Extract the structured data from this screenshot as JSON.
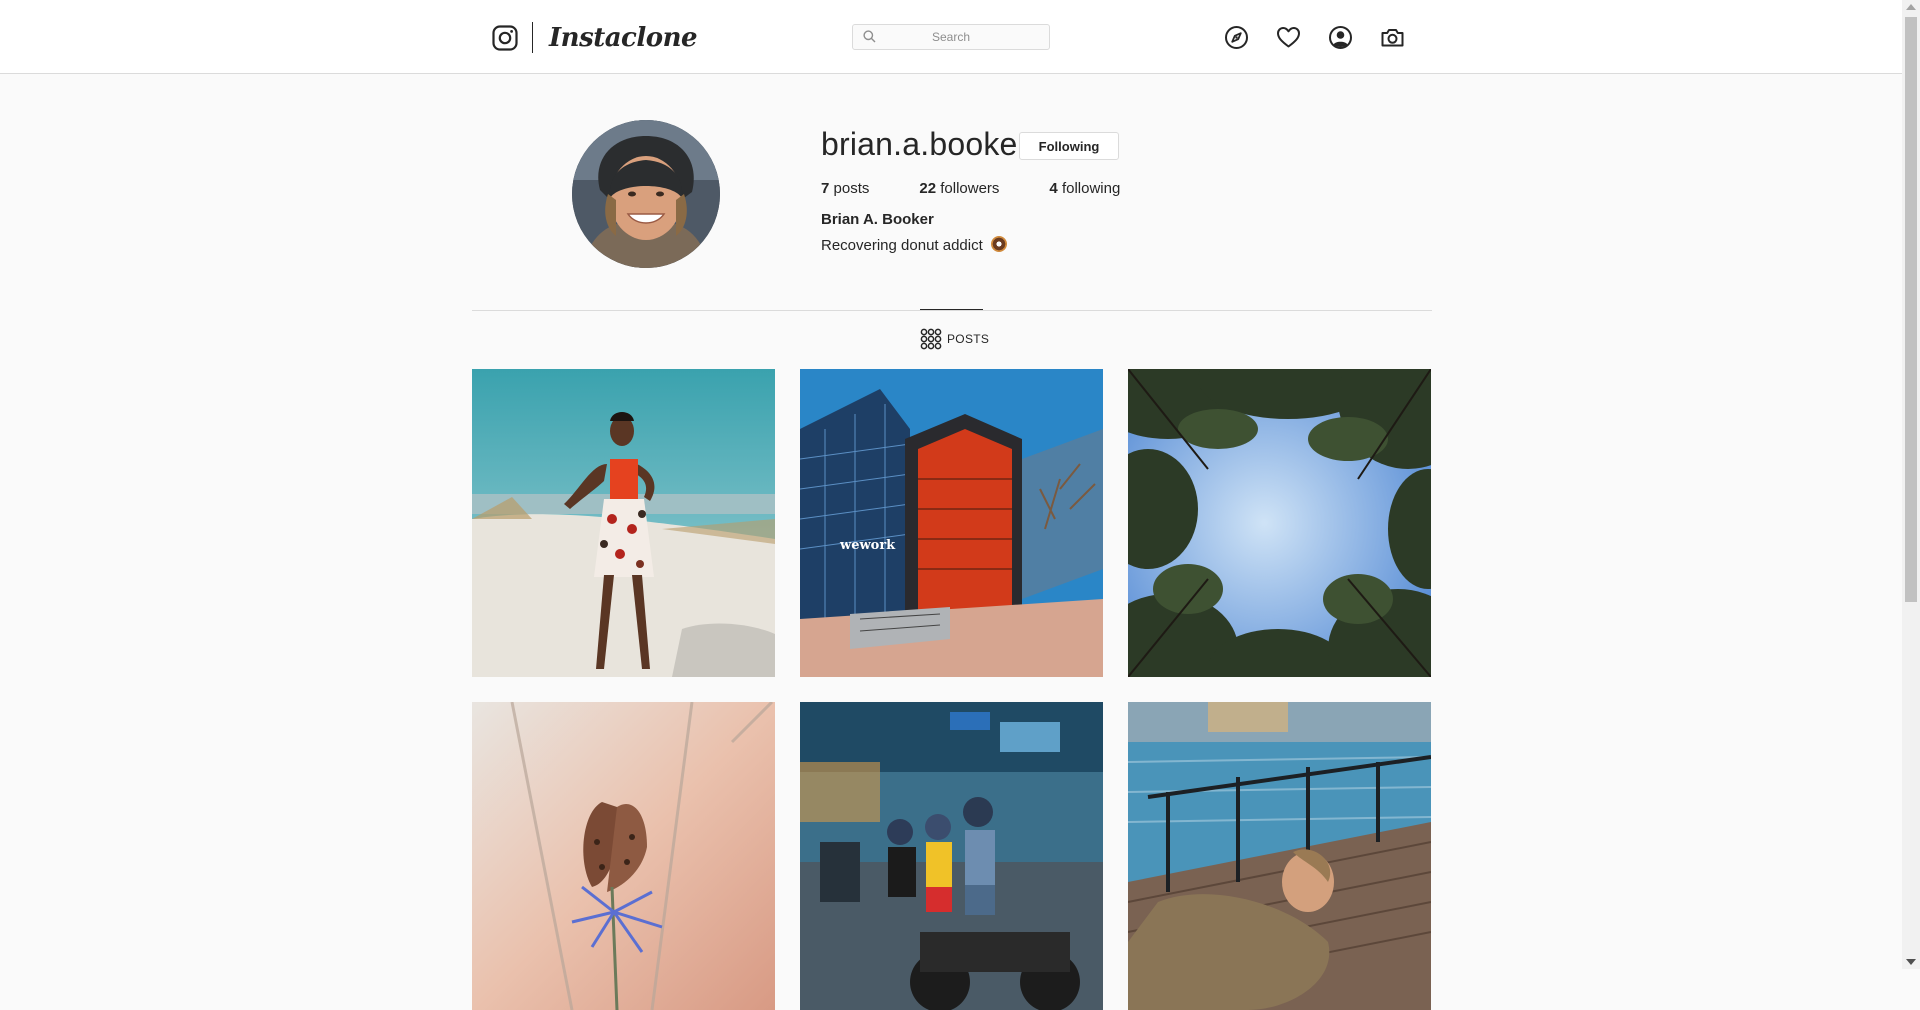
{
  "app": {
    "name": "Instaclone"
  },
  "search": {
    "placeholder": "Search"
  },
  "nav": [
    "compass-icon",
    "heart-icon",
    "user-icon",
    "camera-icon"
  ],
  "profile": {
    "username": "brian.a.booker",
    "follow_label": "Following",
    "stats": [
      {
        "count": "7",
        "label": "posts"
      },
      {
        "count": "22",
        "label": "followers"
      },
      {
        "count": "4",
        "label": "following"
      }
    ],
    "full_name": "Brian A. Booker",
    "bio": "Recovering donut addict"
  },
  "tabs": {
    "posts_label": "POSTS"
  },
  "colors": {
    "accent": "#262626",
    "border": "#dbdbdb",
    "background": "#fafafa"
  }
}
